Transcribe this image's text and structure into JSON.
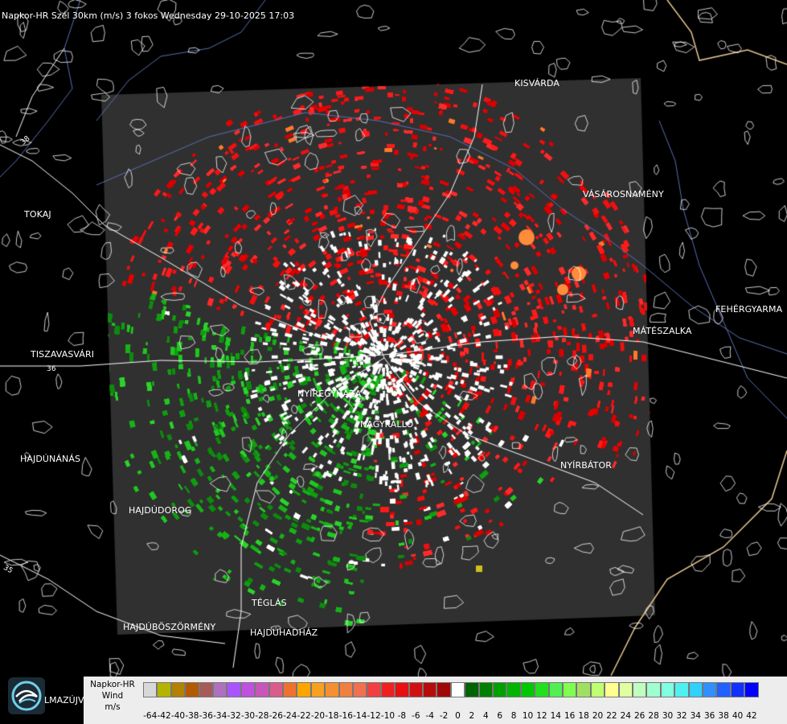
{
  "title": "Napkor-HR Szél 30km (m/s) 3 fokos Wednesday 29-10-2025 17:03",
  "cities": [
    {
      "id": "kisvarda",
      "name": "KISVÁRDA"
    },
    {
      "id": "tokaj",
      "name": "TOKAJ"
    },
    {
      "id": "vasarosnameny",
      "name": "VÁSÁROSNAMÉNY"
    },
    {
      "id": "fehergyarmat",
      "name": "FEHÉRGYARMA"
    },
    {
      "id": "mateszalka",
      "name": "MÁTÉSZALKA"
    },
    {
      "id": "tiszavasvari",
      "name": "TISZAVASVÁRI"
    },
    {
      "id": "nyiregyhaza",
      "name": "NYÍREGYHÁZA"
    },
    {
      "id": "nagykallo",
      "name": "NAGYKÁLLÓ"
    },
    {
      "id": "hajdunanas",
      "name": "HAJDÚNÁNÁS"
    },
    {
      "id": "nyirbator",
      "name": "NYÍRBÁTOR"
    },
    {
      "id": "hajdudorog",
      "name": "HAJDÚDOROG"
    },
    {
      "id": "teglas",
      "name": "TÉGLÁS"
    },
    {
      "id": "hajduboszormeny",
      "name": "HAJDÚBÖSZÖRMÉNY"
    },
    {
      "id": "hajduhadhaz",
      "name": "HAJDÚHADHÁZ"
    }
  ],
  "roads": [
    "35",
    "36",
    "38"
  ],
  "logo_text": "LMAZÚJVÁR",
  "legend": {
    "line1": "Napkor-HR",
    "line2": "Wind",
    "unit": "m/s",
    "ticks": [
      "-64",
      "-42",
      "-40",
      "-38",
      "-36",
      "-34",
      "-32",
      "-30",
      "-28",
      "-26",
      "-24",
      "-22",
      "-20",
      "-18",
      "-16",
      "-14",
      "-12",
      "-10",
      "-8",
      "-6",
      "-4",
      "-2",
      "0",
      "2",
      "4",
      "6",
      "8",
      "10",
      "12",
      "14",
      "16",
      "18",
      "20",
      "22",
      "24",
      "26",
      "28",
      "30",
      "32",
      "34",
      "36",
      "38",
      "40",
      "42"
    ],
    "colors": [
      "#d8d8d8",
      "#b3b300",
      "#b38000",
      "#b35a00",
      "#a85a5a",
      "#b070c0",
      "#a855ff",
      "#c050e0",
      "#c855b8",
      "#d95c8a",
      "#f07030",
      "#ffa500",
      "#f8a020",
      "#f49030",
      "#f08040",
      "#f07050",
      "#f04040",
      "#f02020",
      "#e81010",
      "#d01010",
      "#b80c0c",
      "#a00808",
      "#ffffff",
      "#006400",
      "#008000",
      "#00a000",
      "#00b400",
      "#00c800",
      "#20e020",
      "#50f050",
      "#80ff50",
      "#a0e060",
      "#c0ff70",
      "#ffff90",
      "#e0ffa0",
      "#c0ffc0",
      "#a0ffd0",
      "#80ffe0",
      "#50f0f0",
      "#30d0ff",
      "#3090ff",
      "#2060ff",
      "#1030ff",
      "#0000ff"
    ]
  }
}
